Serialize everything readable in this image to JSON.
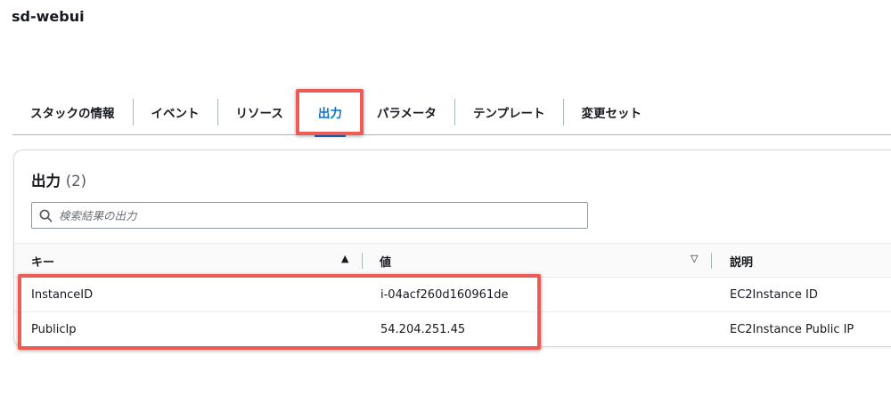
{
  "stack": {
    "title": "sd-webui"
  },
  "tabs": [
    {
      "label": "スタックの情報"
    },
    {
      "label": "イベント"
    },
    {
      "label": "リソース"
    },
    {
      "label": "出力"
    },
    {
      "label": "パラメータ"
    },
    {
      "label": "テンプレート"
    },
    {
      "label": "変更セット"
    }
  ],
  "active_tab": "出力",
  "outputs": {
    "title": "出力",
    "count": "(2)",
    "search": {
      "placeholder": "検索結果の出力",
      "value": ""
    },
    "columns": {
      "key": "キー",
      "value": "値",
      "description": "説明"
    },
    "sort": {
      "key_icon": "▲",
      "value_icon": "▽"
    },
    "rows": [
      {
        "key": "InstanceID",
        "value": "i-04acf260d160961de",
        "description": "EC2Instance ID"
      },
      {
        "key": "PublicIp",
        "value": "54.204.251.45",
        "description": "EC2Instance Public IP"
      }
    ]
  },
  "colors": {
    "accent": "#0972d3",
    "highlight": "#ee5b54"
  },
  "icons": {
    "search": "search-icon",
    "sort_asc": "sort-ascending-icon",
    "sort_desc": "sort-descending-icon"
  }
}
